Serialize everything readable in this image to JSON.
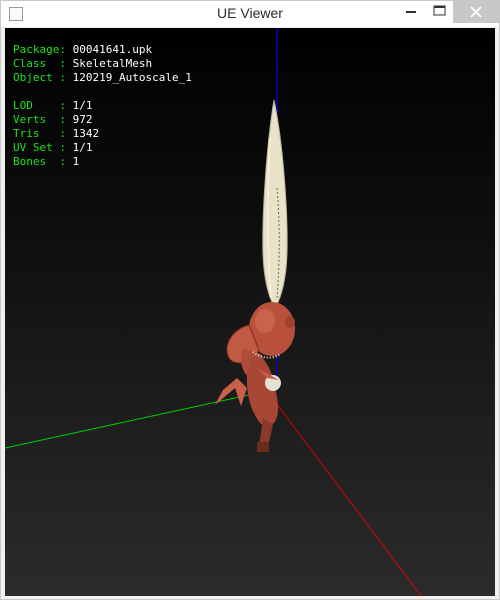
{
  "window": {
    "title": "UE Viewer"
  },
  "info": {
    "package": {
      "label": "Package:",
      "value": "00041641.upk"
    },
    "class": {
      "label": "Class  :",
      "value": "SkeletalMesh"
    },
    "object": {
      "label": "Object :",
      "value": "120219_Autoscale_1"
    },
    "lod": {
      "label": "LOD    :",
      "value": "1/1"
    },
    "verts": {
      "label": "Verts  :",
      "value": "972"
    },
    "tris": {
      "label": "Tris   :",
      "value": "1342"
    },
    "uvset": {
      "label": "UV Set :",
      "value": "1/1"
    },
    "bones": {
      "label": "Bones  :",
      "value": "1"
    }
  },
  "colors": {
    "info_label": "#18e618",
    "info_value": "#ffffff",
    "axis_x": "#e00000",
    "axis_y": "#00d000",
    "axis_z": "#0000ff",
    "character_body": "#b8503c",
    "horn": "#e8e2c8"
  },
  "icons": {
    "app": "app-window-icon",
    "minimize": "minimize-icon",
    "maximize": "maximize-icon",
    "close": "close-icon"
  }
}
